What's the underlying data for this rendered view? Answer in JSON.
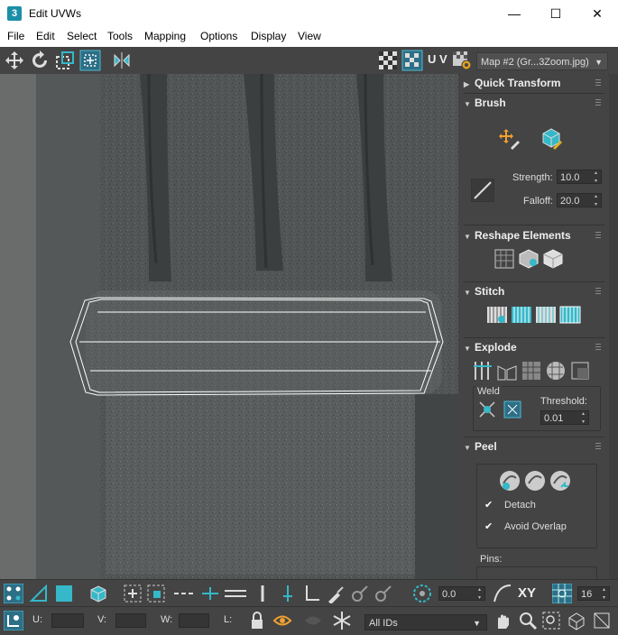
{
  "window": {
    "title": "Edit UVWs",
    "app_icon": "3",
    "minimize": "—",
    "maximize": "☐",
    "close": "✕"
  },
  "menu": [
    "File",
    "Edit",
    "Select",
    "Tools",
    "Mapping",
    "Options",
    "Display",
    "View"
  ],
  "toolbar": {
    "uv_label": "U V",
    "map_select": "Map #2 (Gr...3Zoom.jpg)"
  },
  "panel": {
    "quick_transform": "Quick Transform",
    "brush": {
      "title": "Brush",
      "strength_label": "Strength:",
      "strength": "10.0",
      "falloff_label": "Falloff:",
      "falloff": "20.0"
    },
    "reshape": {
      "title": "Reshape Elements"
    },
    "stitch": {
      "title": "Stitch"
    },
    "explode": {
      "title": "Explode",
      "weld_label": "Weld",
      "threshold_label": "Threshold:",
      "threshold": "0.01"
    },
    "peel": {
      "title": "Peel",
      "detach": "Detach",
      "avoid_overlap": "Avoid Overlap",
      "pins": "Pins:"
    }
  },
  "bottom": {
    "rotation_value": "0.0",
    "xy_label": "XY",
    "grid_value": "16",
    "u_label": "U:",
    "v_label": "V:",
    "w_label": "W:",
    "l_label": "L:",
    "ids_select": "All IDs"
  },
  "colors": {
    "accent": "#35b8c8",
    "panel_bg": "#444444",
    "title_bg": "#ffffff"
  }
}
